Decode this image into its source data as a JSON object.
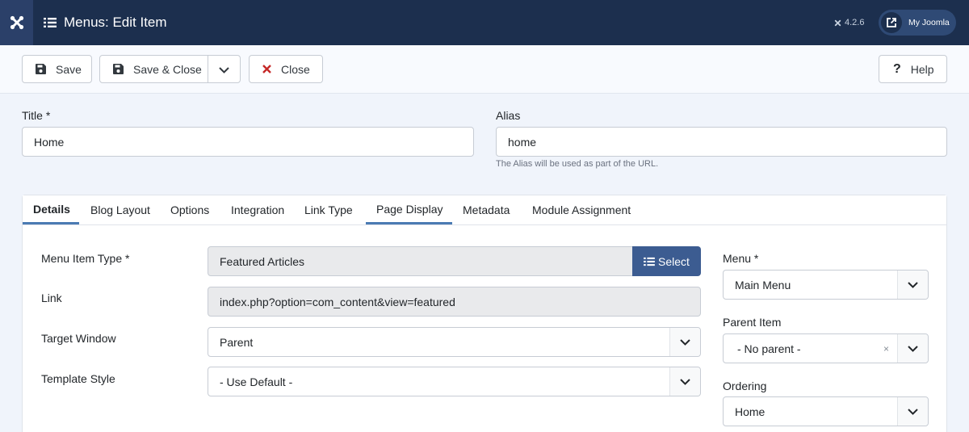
{
  "header": {
    "title": "Menus: Edit Item",
    "version": "4.2.6",
    "my_joomla": "My Joomla"
  },
  "toolbar": {
    "save": "Save",
    "save_close": "Save & Close",
    "close": "Close",
    "help": "Help"
  },
  "form": {
    "title_label": "Title *",
    "title_value": "Home",
    "alias_label": "Alias",
    "alias_value": "home",
    "alias_hint": "The Alias will be used as part of the URL."
  },
  "tabs": [
    "Details",
    "Blog Layout",
    "Options",
    "Integration",
    "Link Type",
    "Page Display",
    "Metadata",
    "Module Assignment"
  ],
  "details": {
    "menu_item_type_label": "Menu Item Type *",
    "menu_item_type_value": "Featured Articles",
    "select_label": "Select",
    "link_label": "Link",
    "link_value": "index.php?option=com_content&view=featured",
    "target_window_label": "Target Window",
    "target_window_value": "Parent",
    "template_style_label": "Template Style",
    "template_style_value": "- Use Default -"
  },
  "sidebar": {
    "menu_label": "Menu *",
    "menu_value": "Main Menu",
    "parent_label": "Parent Item",
    "parent_value": "- No parent -",
    "parent_clear": "×",
    "ordering_label": "Ordering",
    "ordering_value": "Home"
  },
  "colors": {
    "header_bg": "#1c2f4e",
    "accent": "#3c5c91",
    "close_icon": "#c52827"
  }
}
